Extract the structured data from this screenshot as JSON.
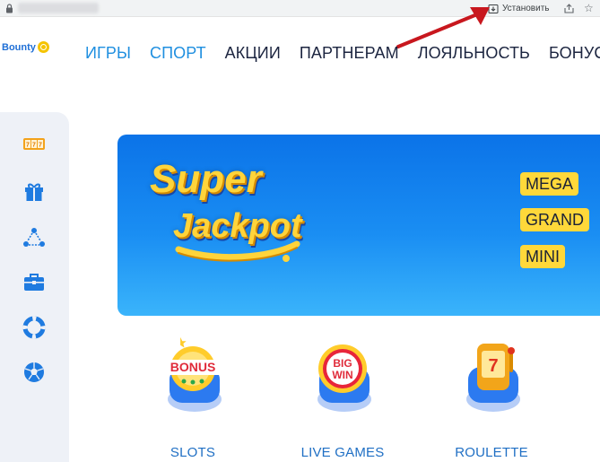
{
  "browser": {
    "install_label": "Установить",
    "icons": [
      "lock-icon",
      "install-icon",
      "share-icon",
      "star-icon"
    ]
  },
  "logo": {
    "text": "Bounty"
  },
  "nav": {
    "items": [
      {
        "label": "ИГРЫ",
        "active": true
      },
      {
        "label": "СПОРТ",
        "active": true
      },
      {
        "label": "АКЦИИ",
        "active": false
      },
      {
        "label": "ПАРТНЕРАМ",
        "active": false
      },
      {
        "label": "ЛОЯЛЬНОСТЬ",
        "active": false
      },
      {
        "label": "БОНУСЫ",
        "active": false
      }
    ]
  },
  "sidebar": {
    "icons": [
      "slots-icon",
      "gift-icon",
      "network-icon",
      "briefcase-icon",
      "lifebuoy-icon",
      "football-icon"
    ]
  },
  "banner": {
    "title_line1": "Super",
    "title_line2": "Jackpot",
    "tiers": [
      "MEGA",
      "GRAND",
      "MINI"
    ]
  },
  "tiles": [
    {
      "label": "SLOTS",
      "badge": "BONUS"
    },
    {
      "label": "LIVE GAMES",
      "badge_line1": "BIG",
      "badge_line2": "WIN"
    },
    {
      "label": "ROULETTE",
      "badge": "7"
    }
  ],
  "colors": {
    "accent_blue": "#1f8fe0",
    "nav_dark": "#1c2540",
    "banner_blue": "#0b73e8",
    "jackpot_yellow": "#ffd43b",
    "annotation_red": "#c8171e"
  }
}
